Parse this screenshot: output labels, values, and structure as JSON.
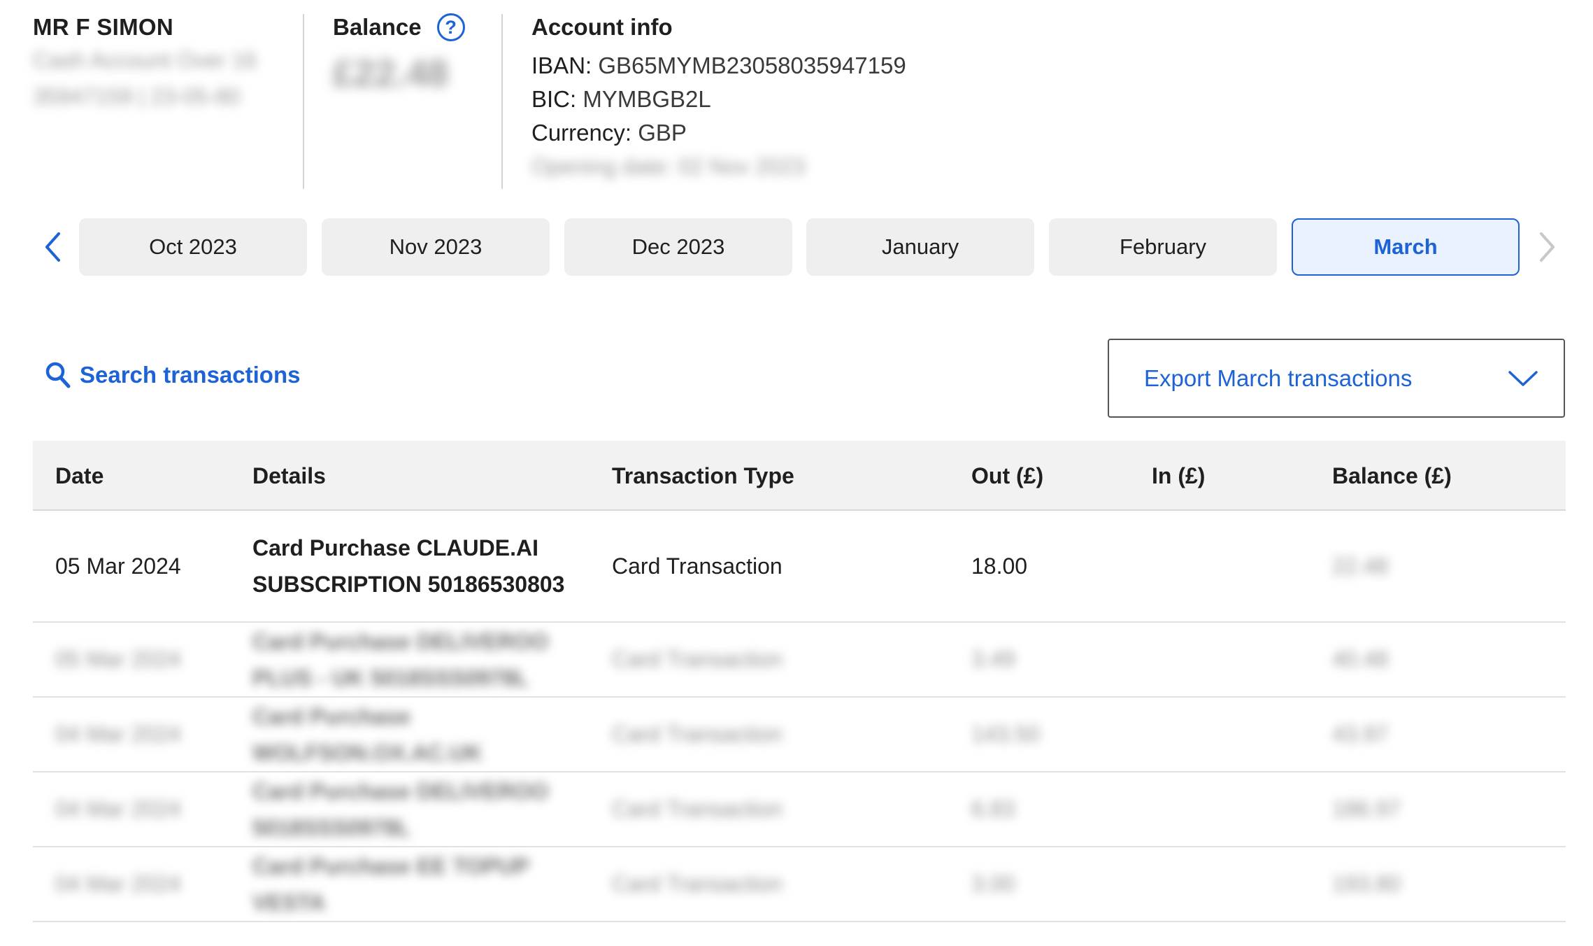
{
  "account": {
    "name": "MR F SIMON",
    "type_blurred": "Cash Account Over 16",
    "number_blurred": "35947159 | 23-05-80"
  },
  "balance": {
    "label": "Balance",
    "amount_blurred": "£22.48",
    "help_icon": "question-circle-icon"
  },
  "account_info": {
    "title": "Account info",
    "iban_label": "IBAN:",
    "iban": "GB65MYMB23058035947159",
    "bic_label": "BIC:",
    "bic": "MYMBGB2L",
    "currency_label": "Currency:",
    "currency": "GBP",
    "opening_blurred": "Opening date: 02 Nov 2023"
  },
  "months": {
    "tabs": [
      {
        "label": "Oct 2023"
      },
      {
        "label": "Nov 2023"
      },
      {
        "label": "Dec 2023"
      },
      {
        "label": "January"
      },
      {
        "label": "February"
      },
      {
        "label": "March"
      }
    ],
    "active": "March"
  },
  "toolbar": {
    "search_label": "Search transactions",
    "export_label": "Export March transactions"
  },
  "table": {
    "headers": [
      "Date",
      "Details",
      "Transaction Type",
      "Out (£)",
      "In (£)",
      "Balance (£)"
    ],
    "rows": [
      {
        "date": "05 Mar 2024",
        "details": "Card Purchase CLAUDE.AI SUBSCRIPTION 50186530803",
        "type": "Card Transaction",
        "out": "18.00",
        "in": "",
        "balance": "22.48"
      },
      {
        "date": "05 Mar 2024",
        "details": "Card Purchase DELIVEROO PLUS - UK 5018SSS0978L",
        "type": "Card Transaction",
        "out": "3.49",
        "in": "",
        "balance": "40.48"
      },
      {
        "date": "04 Mar 2024",
        "details": "Card Purchase WOLFSON.OX.AC.UK",
        "type": "Card Transaction",
        "out": "143.50",
        "in": "",
        "balance": "43.97"
      },
      {
        "date": "04 Mar 2024",
        "details": "Card Purchase DELIVEROO 5018SSS0978L",
        "type": "Card Transaction",
        "out": "6.83",
        "in": "",
        "balance": "186.97"
      },
      {
        "date": "04 Mar 2024",
        "details": "Card Purchase EE TOPUP VESTA",
        "type": "Card Transaction",
        "out": "3.00",
        "in": "",
        "balance": "193.80"
      }
    ]
  },
  "colors": {
    "accent": "#1d63d6",
    "tab_bg": "#efefef",
    "active_tab_bg": "#eaf1ff",
    "header_bg": "#f2f2f2"
  }
}
